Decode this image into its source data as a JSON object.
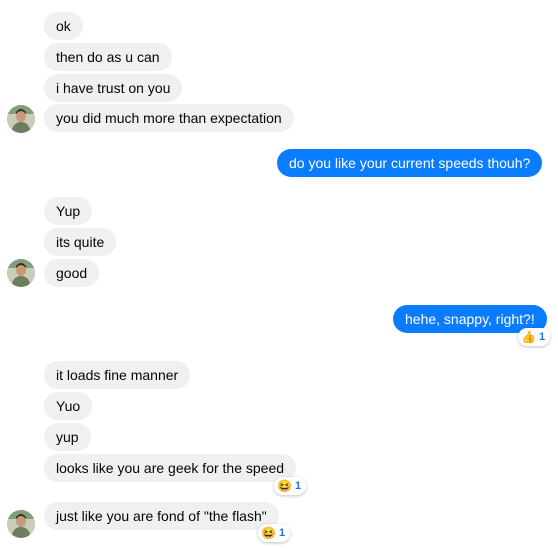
{
  "conversation": {
    "group1": [
      "ok",
      "then do as u can",
      "i have trust on you",
      "you did much more than expectation"
    ],
    "out1": "do you like your current speeds thouh?",
    "group2": [
      "Yup",
      "its quite",
      "good"
    ],
    "out2": "hehe, snappy, right?!",
    "group3": [
      "it loads fine manner",
      "Yuo",
      "yup",
      "looks like you are geek for  the speed",
      "just like you are fond of  \"the flash\""
    ]
  },
  "reactions": {
    "out2": {
      "emoji": "👍",
      "icon": "thumbs-up-icon",
      "count": "1"
    },
    "msg_geek": {
      "emoji": "😆",
      "icon": "laughing-emoji-icon",
      "count": "1"
    },
    "msg_flash": {
      "emoji": "😆",
      "icon": "laughing-emoji-icon",
      "count": "1"
    }
  },
  "colors": {
    "incoming_bubble": "#f0f0f0",
    "outgoing_bubble": "#0a7cff",
    "reaction_count": "#1a73e8"
  }
}
